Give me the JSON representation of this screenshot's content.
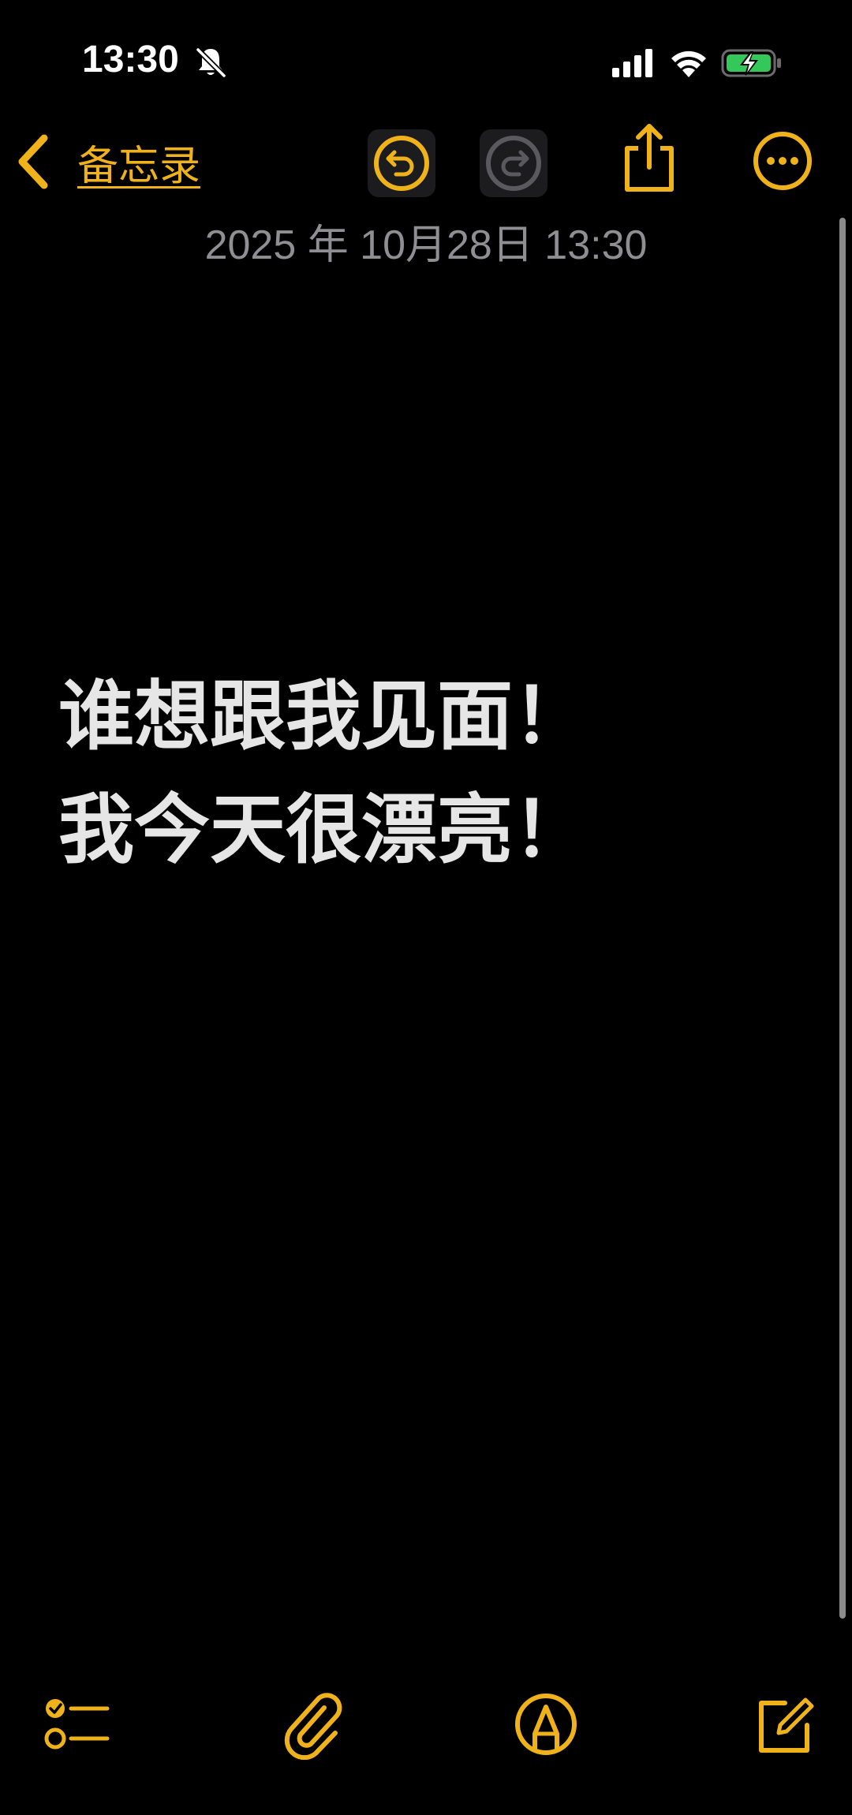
{
  "status_bar": {
    "time": "13:30",
    "icons": [
      "bell-slash-icon",
      "cellular-signal-icon",
      "wifi-icon",
      "battery-charging-icon"
    ]
  },
  "nav": {
    "back_label": "备忘录",
    "icons": [
      "chevron-left-icon",
      "undo-icon",
      "redo-icon",
      "share-icon",
      "more-icon"
    ]
  },
  "note": {
    "date": "2025 年 10月28日 13:30",
    "lines": [
      "谁想跟我见面！",
      "我今天很漂亮！"
    ]
  },
  "toolbar": {
    "icons": [
      "checklist-icon",
      "paperclip-icon",
      "markup-pen-icon",
      "compose-icon"
    ]
  },
  "colors": {
    "accent": "#f0b21a",
    "background": "#000000",
    "text": "#e6e6e6",
    "secondary_text": "#8e8e93",
    "battery_fill": "#34c759"
  }
}
